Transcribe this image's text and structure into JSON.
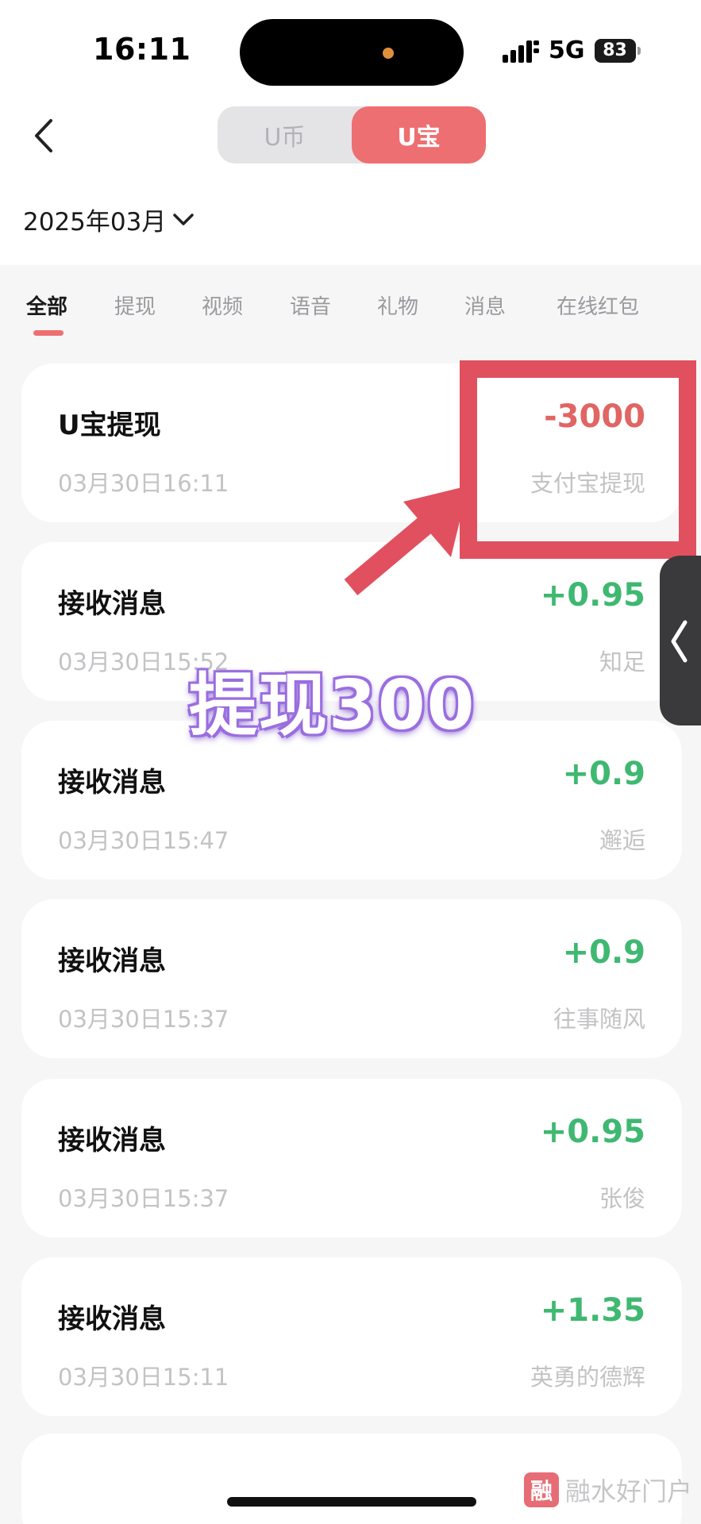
{
  "status_bar": {
    "time": "16:11",
    "network": "5G",
    "battery": "83"
  },
  "header": {
    "seg_coin": "U币",
    "seg_bao": "U宝",
    "month": "2025年03月"
  },
  "tabs": [
    "全部",
    "提现",
    "视频",
    "语音",
    "礼物",
    "消息",
    "在线红包"
  ],
  "records": [
    {
      "title": "U宝提现",
      "time": "03月30日16:11",
      "amount": "-3000",
      "sub": "支付宝提现"
    },
    {
      "title": "接收消息",
      "time": "03月30日15:52",
      "amount": "+0.95",
      "sub": "知足"
    },
    {
      "title": "接收消息",
      "time": "03月30日15:47",
      "amount": "+0.9",
      "sub": "邂逅"
    },
    {
      "title": "接收消息",
      "time": "03月30日15:37",
      "amount": "+0.9",
      "sub": "往事随风"
    },
    {
      "title": "接收消息",
      "time": "03月30日15:37",
      "amount": "+0.95",
      "sub": "张俊"
    },
    {
      "title": "接收消息",
      "time": "03月30日15:11",
      "amount": "+1.35",
      "sub": "英勇的德辉"
    }
  ],
  "overlay": {
    "promo_text": "提现300"
  },
  "watermark": {
    "logo": "融",
    "text": "融水好门户"
  },
  "colors": {
    "accent": "#ee6f71",
    "income": "#3fb871",
    "expense": "#e06563",
    "annotation": "#e1505f"
  }
}
